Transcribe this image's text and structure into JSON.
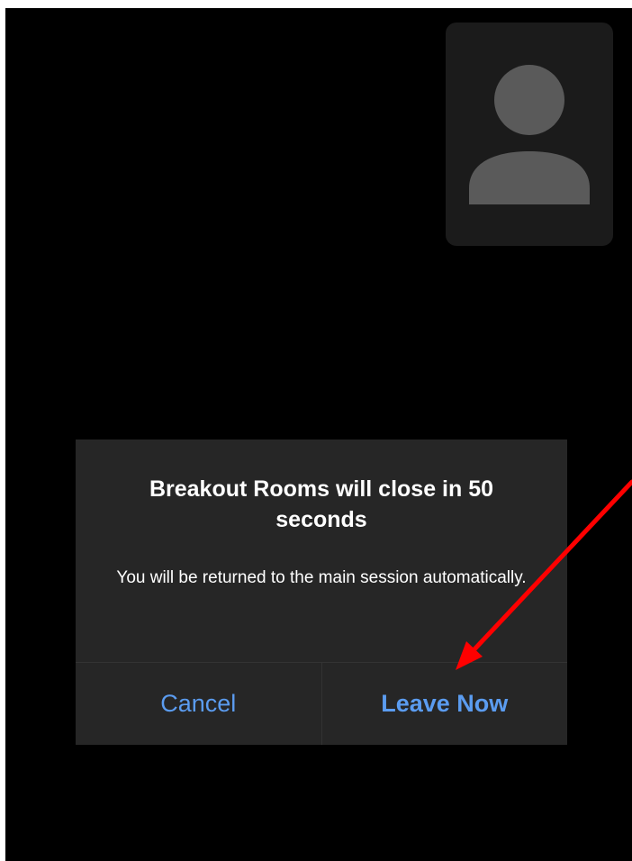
{
  "dialog": {
    "title": "Breakout Rooms will close in 50 seconds",
    "message": "You will be returned to the main session automatically.",
    "cancel_label": "Cancel",
    "leave_label": "Leave Now"
  },
  "self_view": {
    "icon": "person-avatar-icon"
  },
  "annotation": {
    "icon": "red-arrow-icon",
    "color": "#ff0000"
  },
  "colors": {
    "background": "#000000",
    "dialog_bg": "#262626",
    "accent": "#5b9cf0",
    "avatar_tile": "#1b1b1b",
    "avatar_glyph": "#5a5a5a"
  }
}
